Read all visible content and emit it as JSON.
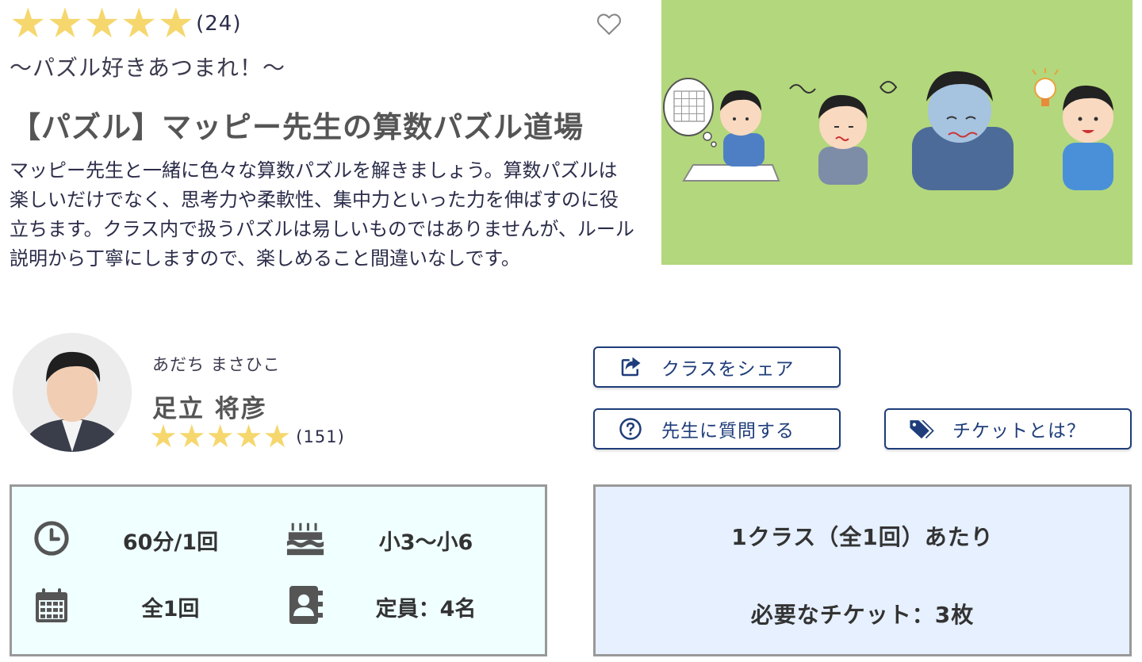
{
  "rating": {
    "stars": 5,
    "filled_stars": 5,
    "count_text": "(24)"
  },
  "subtitle": "〜パズル好きあつまれ！〜",
  "title": "【パズル】マッピー先生の算数パズル道場",
  "description": "マッピー先生と一緒に色々な算数パズルを解きましょう。算数パズルは楽しいだけでなく、思考力や柔軟性、集中力といった力を伸ばすのに役立ちます。クラス内で扱うパズルは易しいものではありませんが、ルール説明から丁寧にしますので、楽しめること間違いなしです。",
  "teacher": {
    "kana": "あだち まさひこ",
    "name": "足立 将彦",
    "stars": 5,
    "rating_count_text": "(151)"
  },
  "buttons": {
    "share_label": "クラスをシェア",
    "question_label": "先生に質問する",
    "ticket_label": "チケットとは？"
  },
  "info": {
    "duration": "60分/1回",
    "grade": "小3〜小6",
    "sessions": "全1回",
    "capacity": "定員：4名"
  },
  "ticket_box": {
    "line1": "1クラス（全1回）あたり",
    "line2": "必要なチケット：3枚"
  },
  "colors": {
    "star": "#f5d76e",
    "button_border": "#1f3d7a",
    "hero_bg": "#b3d77c",
    "info_bg": "#f0ffff",
    "ticket_bg": "#e6f0ff"
  },
  "icons": {
    "favorite": "heart-outline-icon",
    "share": "share-icon",
    "question": "question-circle-icon",
    "ticket": "tags-icon",
    "duration": "clock-icon",
    "grade": "birthday-cake-icon",
    "sessions": "calendar-icon",
    "capacity": "address-book-icon"
  }
}
